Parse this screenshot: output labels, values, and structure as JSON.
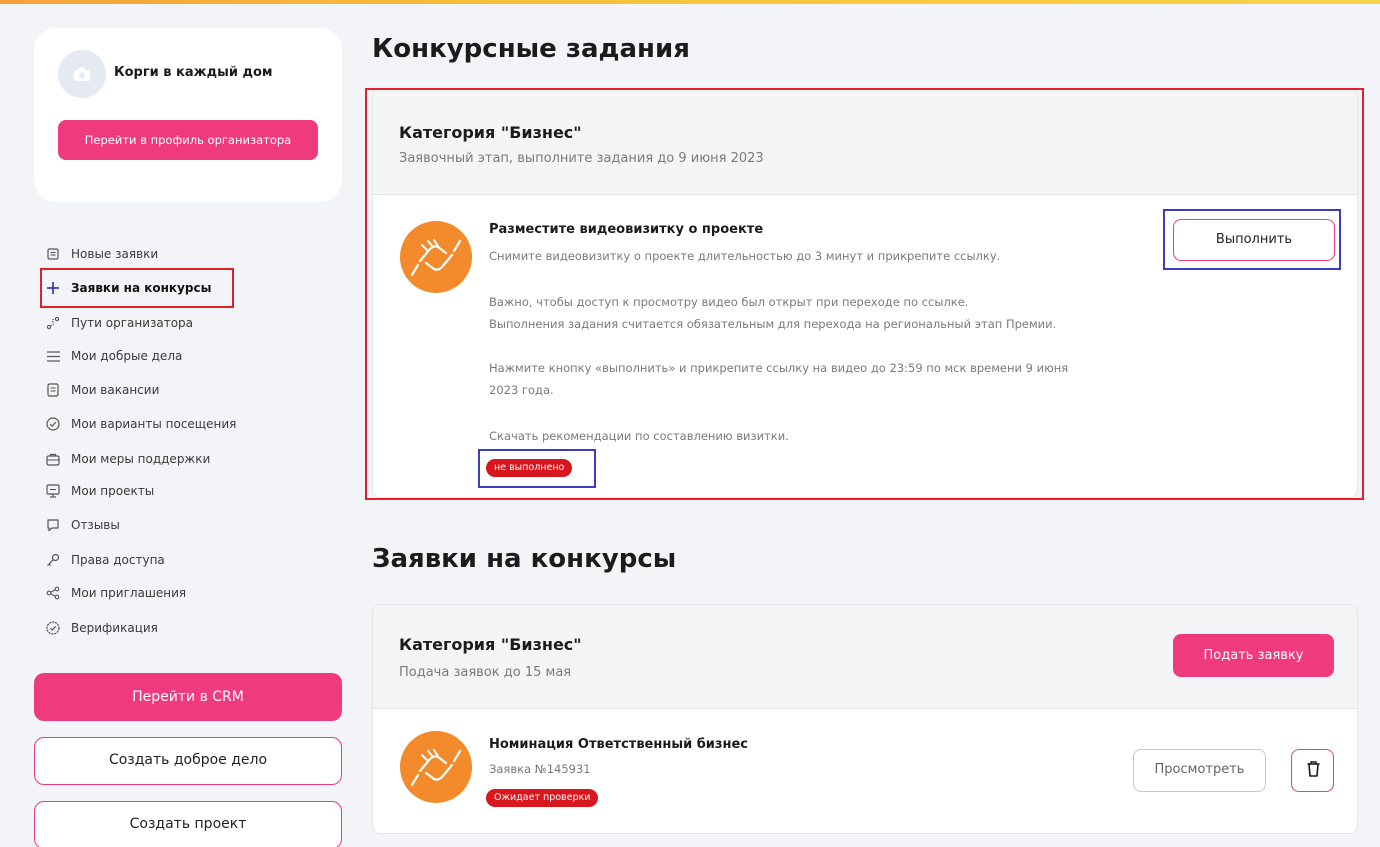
{
  "colors": {
    "accent": "#ef3b7d",
    "danger": "#d8161e",
    "emblem": "#f38a2b",
    "highlight_red": "#e0202c",
    "highlight_blue": "#3c3cc0"
  },
  "profile": {
    "org_name": "Корги в каждый дом",
    "profile_button": "Перейти в профиль организатора"
  },
  "nav": {
    "items": [
      {
        "label": "Новые заявки",
        "icon": "new-requests-icon"
      },
      {
        "label": "Заявки на конкурсы",
        "icon": "plus-icon"
      },
      {
        "label": "Пути организатора",
        "icon": "route-icon"
      },
      {
        "label": "Мои добрые дела",
        "icon": "list-icon"
      },
      {
        "label": "Мои вакансии",
        "icon": "vacancy-icon"
      },
      {
        "label": "Мои варианты посещения",
        "icon": "check-circle-icon"
      },
      {
        "label": "Мои меры поддержки",
        "icon": "support-icon"
      },
      {
        "label": "Мои проекты",
        "icon": "projects-icon"
      },
      {
        "label": "Отзывы",
        "icon": "comment-icon"
      },
      {
        "label": "Права доступа",
        "icon": "key-icon"
      },
      {
        "label": "Мои приглашения",
        "icon": "share-icon"
      },
      {
        "label": "Верификация",
        "icon": "verified-icon"
      }
    ],
    "active": "Заявки на конкурсы"
  },
  "sidebar_buttons": {
    "crm": "Перейти в CRM",
    "create_deed": "Создать доброе дело",
    "create_project": "Создать проект"
  },
  "tasks_section": {
    "heading": "Конкурсные задания",
    "category_title": "Категория \"Бизнес\"",
    "category_subtitle": "Заявочный этап, выполните задания до 9 июня 2023",
    "task": {
      "title": "Разместите видеовизитку о проекте",
      "line1": "Снимите видеовизитку о проекте длительностью до 3 минут и прикрепите ссылку.",
      "line2": "Важно, чтобы доступ к просмотру видео был открыт при переходе по ссылке.",
      "line3": "Выполнения задания считается обязательным для перехода на региональный этап Премии.",
      "line4": "Нажмите кнопку «выполнить» и прикрепите ссылку на видео до 23:59 по мск времени 9 июня",
      "line5": "2023 года.",
      "line6": "Скачать рекомендации по составлению визитки.",
      "status": "не выполнено",
      "action": "Выполнить"
    }
  },
  "applications_section": {
    "heading": "Заявки на конкурсы",
    "category_title": "Категория \"Бизнес\"",
    "category_subtitle": "Подача заявок до 15 мая",
    "submit_button": "Подать заявку",
    "item": {
      "title": "Номинация Ответственный бизнес",
      "number": "Заявка №145931",
      "status": "Ожидает проверки",
      "view_button": "Просмотреть"
    }
  }
}
